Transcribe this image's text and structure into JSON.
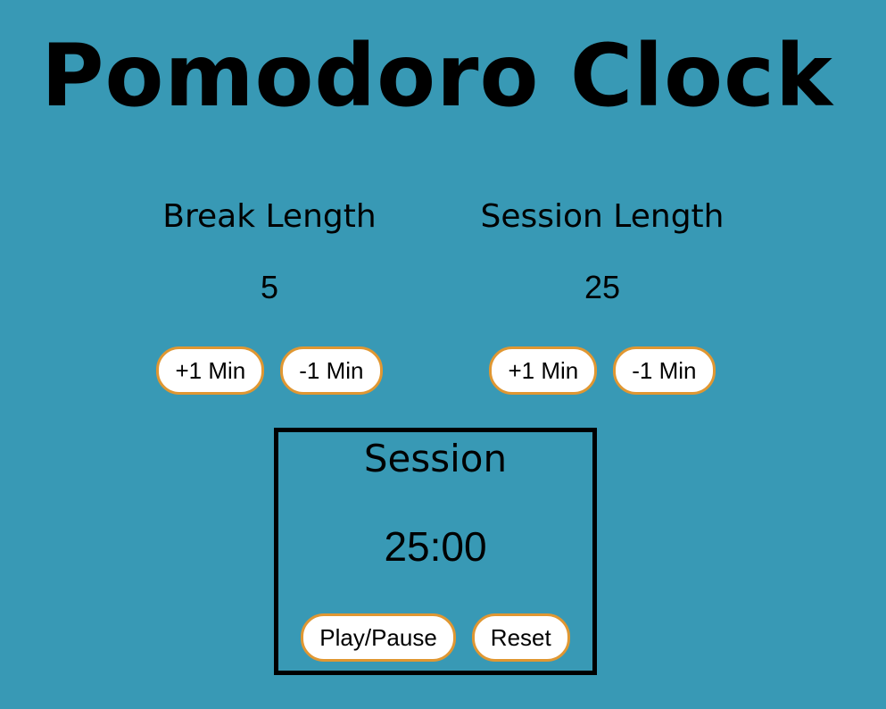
{
  "page": {
    "title": "Pomodoro Clock"
  },
  "break": {
    "label": "Break Length",
    "value": "5",
    "increment_label": "+1 Min",
    "decrement_label": "-1 Min"
  },
  "session": {
    "label": "Session Length",
    "value": "25",
    "increment_label": "+1 Min",
    "decrement_label": "-1 Min"
  },
  "timer": {
    "label": "Session",
    "time": "25:00",
    "play_pause_label": "Play/Pause",
    "reset_label": "Reset"
  },
  "colors": {
    "background": "#3899b5",
    "button_border": "#e09732",
    "button_bg": "#ffffff",
    "text": "#000000"
  }
}
